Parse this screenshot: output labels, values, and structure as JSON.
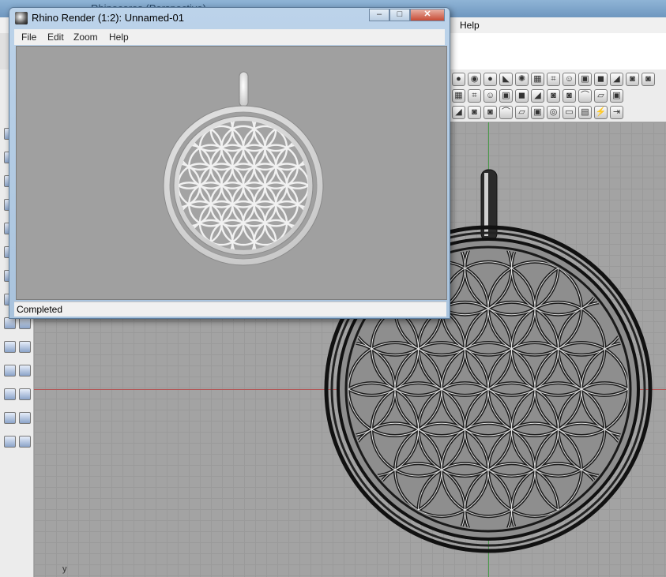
{
  "main_window": {
    "title": "Rhinoceros (Perspective)",
    "menu": {
      "help": "Help"
    }
  },
  "viewport": {
    "label": "y"
  },
  "render_window": {
    "title": "Rhino Render (1:2): Unnamed-01",
    "menu": [
      "File",
      "Edit",
      "Zoom",
      "Help"
    ],
    "status": "Completed",
    "buttons": {
      "minimize": "–",
      "maximize": "□",
      "close": "✕"
    }
  },
  "colors": {
    "x_axis": "#b35656",
    "y_axis": "#4a9a4a",
    "render_background": "#a0a0a0",
    "viewport_background": "#a3a3a3"
  },
  "toolbar_icons": {
    "row1": [
      "sphere-icon",
      "globe-gl-icon",
      "blue-sphere-icon",
      "flag-icon",
      "gear-render-icon",
      "grid-icon",
      "snap-icon",
      "face-icon",
      "texture-icon",
      "box-icon",
      "slope-icon",
      "camera-icon",
      "camera2-icon"
    ],
    "row2": [
      "curve-icon",
      "extrude-icon",
      "cube-icon",
      "tube-icon",
      "slab-icon",
      "file-icon",
      "bolt-icon",
      "arrow-icon",
      "stamp-icon",
      "copy-icon",
      "split-icon"
    ],
    "row3": [
      "arrow-cursor-icon",
      "transform-icon",
      "fillet-icon",
      "blend-icon",
      "chamfer-icon",
      "curve-ops-icon",
      "pen-icon",
      "view-cube1-icon",
      "view-cube2-icon",
      "view-cube3-icon",
      "view-cube4-icon"
    ]
  }
}
